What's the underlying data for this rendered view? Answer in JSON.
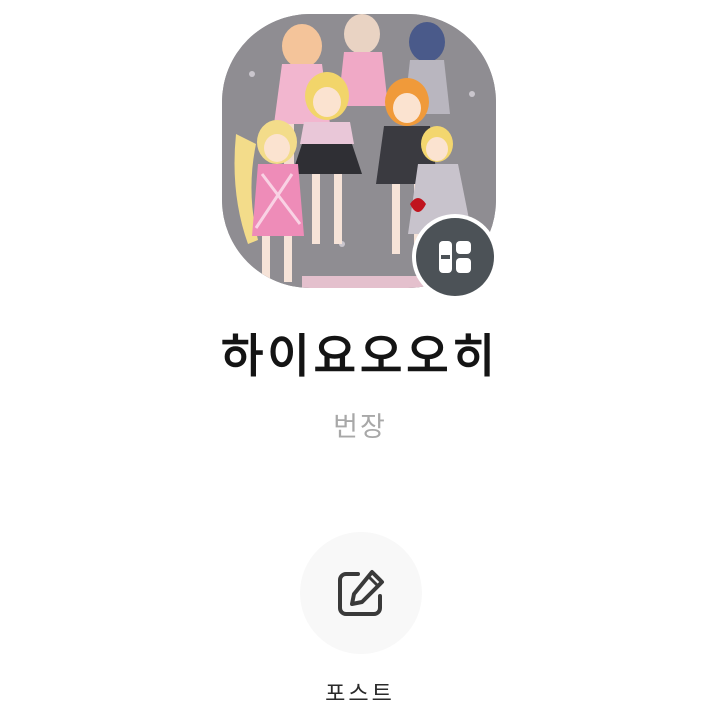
{
  "profile": {
    "name": "하이요오오히",
    "subtitle": "번장",
    "image_icon": "anime-characters-image",
    "badge_icon": "profile-switch-icon"
  },
  "actions": {
    "post_label": "포스트",
    "post_icon": "edit-pencil-icon"
  },
  "colors": {
    "name_text": "#141414",
    "subtitle_text": "#a8a8a8",
    "badge_bg": "#4c5257",
    "post_button_bg": "#f8f8f8",
    "icon_stroke": "#3a3a3a"
  }
}
